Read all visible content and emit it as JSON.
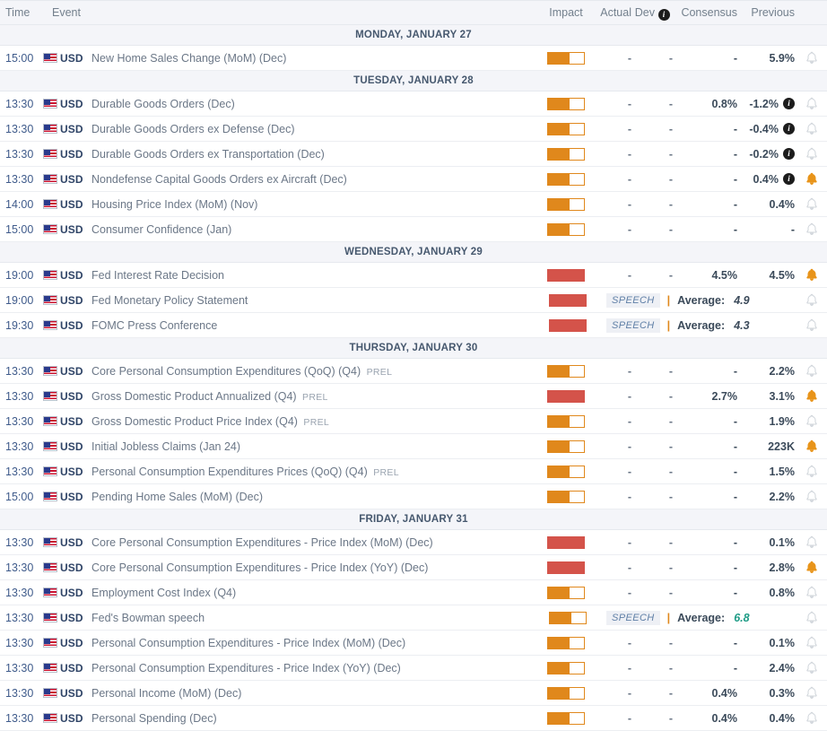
{
  "header": {
    "time": "Time",
    "event": "Event",
    "impact": "Impact",
    "actual": "Actual",
    "dev": "Dev",
    "info_icon": "i",
    "consensus": "Consensus",
    "previous": "Previous"
  },
  "colors": {
    "impact_medium": "#e0881c",
    "impact_high": "#d4534a",
    "bell_active": "#e8941a",
    "bell_inactive": "#cfd4da",
    "green_value": "#1f9c86",
    "day_header_bg": "#f4f5f9",
    "time_text": "#3f5b8b"
  },
  "days": [
    {
      "label": "MONDAY, JANUARY 27",
      "rows": [
        {
          "time": "15:00",
          "currency": "USD",
          "flag": "us-flag-icon",
          "event": "New Home Sales Change (MoM) (Dec)",
          "prel": "",
          "impact": "medium",
          "actual": "-",
          "dev": "-",
          "consensus": "-",
          "previous": "5.9%",
          "revised": false,
          "bell": "inactive"
        }
      ]
    },
    {
      "label": "TUESDAY, JANUARY 28",
      "rows": [
        {
          "time": "13:30",
          "currency": "USD",
          "flag": "us-flag-icon",
          "event": "Durable Goods Orders (Dec)",
          "prel": "",
          "impact": "medium",
          "actual": "-",
          "dev": "-",
          "consensus": "0.8%",
          "previous": "-1.2%",
          "revised": true,
          "bell": "inactive"
        },
        {
          "time": "13:30",
          "currency": "USD",
          "flag": "us-flag-icon",
          "event": "Durable Goods Orders ex Defense (Dec)",
          "prel": "",
          "impact": "medium",
          "actual": "-",
          "dev": "-",
          "consensus": "-",
          "previous": "-0.4%",
          "revised": true,
          "bell": "inactive"
        },
        {
          "time": "13:30",
          "currency": "USD",
          "flag": "us-flag-icon",
          "event": "Durable Goods Orders ex Transportation (Dec)",
          "prel": "",
          "impact": "medium",
          "actual": "-",
          "dev": "-",
          "consensus": "-",
          "previous": "-0.2%",
          "revised": true,
          "bell": "inactive"
        },
        {
          "time": "13:30",
          "currency": "USD",
          "flag": "us-flag-icon",
          "event": "Nondefense Capital Goods Orders ex Aircraft (Dec)",
          "prel": "",
          "impact": "medium",
          "actual": "-",
          "dev": "-",
          "consensus": "-",
          "previous": "0.4%",
          "revised": true,
          "bell": "active"
        },
        {
          "time": "14:00",
          "currency": "USD",
          "flag": "us-flag-icon",
          "event": "Housing Price Index (MoM) (Nov)",
          "prel": "",
          "impact": "medium",
          "actual": "-",
          "dev": "-",
          "consensus": "-",
          "previous": "0.4%",
          "revised": false,
          "bell": "inactive"
        },
        {
          "time": "15:00",
          "currency": "USD",
          "flag": "us-flag-icon",
          "event": "Consumer Confidence (Jan)",
          "prel": "",
          "impact": "medium",
          "actual": "-",
          "dev": "-",
          "consensus": "-",
          "previous": "-",
          "revised": false,
          "bell": "inactive"
        }
      ]
    },
    {
      "label": "WEDNESDAY, JANUARY 29",
      "rows": [
        {
          "time": "19:00",
          "currency": "USD",
          "flag": "us-flag-icon",
          "event": "Fed Interest Rate Decision",
          "prel": "",
          "impact": "high",
          "actual": "-",
          "dev": "-",
          "consensus": "4.5%",
          "previous": "4.5%",
          "revised": false,
          "bell": "active"
        },
        {
          "time": "19:00",
          "currency": "USD",
          "flag": "us-flag-icon",
          "event": "Fed Monetary Policy Statement",
          "prel": "",
          "impact": "high",
          "speech": true,
          "speech_badge": "SPEECH",
          "average_label": "Average:",
          "average_value": "4.9",
          "average_green": false,
          "bell": "inactive"
        },
        {
          "time": "19:30",
          "currency": "USD",
          "flag": "us-flag-icon",
          "event": "FOMC Press Conference",
          "prel": "",
          "impact": "high",
          "speech": true,
          "speech_badge": "SPEECH",
          "average_label": "Average:",
          "average_value": "4.3",
          "average_green": false,
          "bell": "inactive"
        }
      ]
    },
    {
      "label": "THURSDAY, JANUARY 30",
      "rows": [
        {
          "time": "13:30",
          "currency": "USD",
          "flag": "us-flag-icon",
          "event": "Core Personal Consumption Expenditures (QoQ) (Q4)",
          "prel": "PREL",
          "impact": "medium",
          "actual": "-",
          "dev": "-",
          "consensus": "-",
          "previous": "2.2%",
          "revised": false,
          "bell": "inactive"
        },
        {
          "time": "13:30",
          "currency": "USD",
          "flag": "us-flag-icon",
          "event": "Gross Domestic Product Annualized (Q4)",
          "prel": "PREL",
          "impact": "high",
          "actual": "-",
          "dev": "-",
          "consensus": "2.7%",
          "previous": "3.1%",
          "revised": false,
          "bell": "active"
        },
        {
          "time": "13:30",
          "currency": "USD",
          "flag": "us-flag-icon",
          "event": "Gross Domestic Product Price Index (Q4)",
          "prel": "PREL",
          "impact": "medium",
          "actual": "-",
          "dev": "-",
          "consensus": "-",
          "previous": "1.9%",
          "revised": false,
          "bell": "inactive"
        },
        {
          "time": "13:30",
          "currency": "USD",
          "flag": "us-flag-icon",
          "event": "Initial Jobless Claims (Jan 24)",
          "prel": "",
          "impact": "medium",
          "actual": "-",
          "dev": "-",
          "consensus": "-",
          "previous": "223K",
          "revised": false,
          "bell": "active"
        },
        {
          "time": "13:30",
          "currency": "USD",
          "flag": "us-flag-icon",
          "event": "Personal Consumption Expenditures Prices (QoQ) (Q4)",
          "prel": "PREL",
          "impact": "medium",
          "actual": "-",
          "dev": "-",
          "consensus": "-",
          "previous": "1.5%",
          "revised": false,
          "bell": "inactive"
        },
        {
          "time": "15:00",
          "currency": "USD",
          "flag": "us-flag-icon",
          "event": "Pending Home Sales (MoM) (Dec)",
          "prel": "",
          "impact": "medium",
          "actual": "-",
          "dev": "-",
          "consensus": "-",
          "previous": "2.2%",
          "revised": false,
          "bell": "inactive"
        }
      ]
    },
    {
      "label": "FRIDAY, JANUARY 31",
      "rows": [
        {
          "time": "13:30",
          "currency": "USD",
          "flag": "us-flag-icon",
          "event": "Core Personal Consumption Expenditures - Price Index (MoM) (Dec)",
          "prel": "",
          "impact": "high",
          "actual": "-",
          "dev": "-",
          "consensus": "-",
          "previous": "0.1%",
          "revised": false,
          "bell": "inactive"
        },
        {
          "time": "13:30",
          "currency": "USD",
          "flag": "us-flag-icon",
          "event": "Core Personal Consumption Expenditures - Price Index (YoY) (Dec)",
          "prel": "",
          "impact": "high",
          "actual": "-",
          "dev": "-",
          "consensus": "-",
          "previous": "2.8%",
          "revised": false,
          "bell": "active"
        },
        {
          "time": "13:30",
          "currency": "USD",
          "flag": "us-flag-icon",
          "event": "Employment Cost Index (Q4)",
          "prel": "",
          "impact": "medium",
          "actual": "-",
          "dev": "-",
          "consensus": "-",
          "previous": "0.8%",
          "revised": false,
          "bell": "inactive"
        },
        {
          "time": "13:30",
          "currency": "USD",
          "flag": "us-flag-icon",
          "event": "Fed's Bowman speech",
          "prel": "",
          "impact": "medium",
          "speech": true,
          "speech_badge": "SPEECH",
          "average_label": "Average:",
          "average_value": "6.8",
          "average_green": true,
          "bell": "inactive"
        },
        {
          "time": "13:30",
          "currency": "USD",
          "flag": "us-flag-icon",
          "event": "Personal Consumption Expenditures - Price Index (MoM) (Dec)",
          "prel": "",
          "impact": "medium",
          "actual": "-",
          "dev": "-",
          "consensus": "-",
          "previous": "0.1%",
          "revised": false,
          "bell": "inactive"
        },
        {
          "time": "13:30",
          "currency": "USD",
          "flag": "us-flag-icon",
          "event": "Personal Consumption Expenditures - Price Index (YoY) (Dec)",
          "prel": "",
          "impact": "medium",
          "actual": "-",
          "dev": "-",
          "consensus": "-",
          "previous": "2.4%",
          "revised": false,
          "bell": "inactive"
        },
        {
          "time": "13:30",
          "currency": "USD",
          "flag": "us-flag-icon",
          "event": "Personal Income (MoM) (Dec)",
          "prel": "",
          "impact": "medium",
          "actual": "-",
          "dev": "-",
          "consensus": "0.4%",
          "previous": "0.3%",
          "revised": false,
          "bell": "inactive"
        },
        {
          "time": "13:30",
          "currency": "USD",
          "flag": "us-flag-icon",
          "event": "Personal Spending (Dec)",
          "prel": "",
          "impact": "medium",
          "actual": "-",
          "dev": "-",
          "consensus": "0.4%",
          "previous": "0.4%",
          "revised": false,
          "bell": "inactive"
        }
      ]
    }
  ]
}
